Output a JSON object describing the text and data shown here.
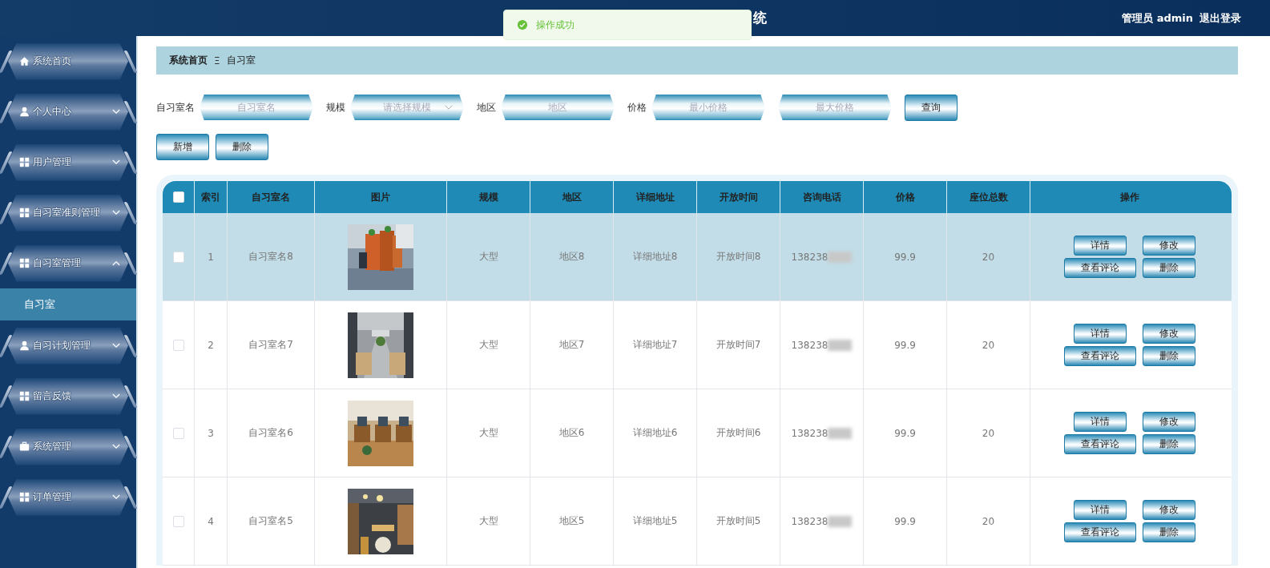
{
  "header": {
    "title": "统",
    "user": "管理员 admin",
    "logout": "退出登录"
  },
  "toast": {
    "kind": "success",
    "message": "操作成功"
  },
  "sidebar": {
    "items": [
      {
        "label": "系统首页"
      },
      {
        "label": "个人中心",
        "expanded": false
      },
      {
        "label": "用户管理",
        "expanded": false
      },
      {
        "label": "自习室准则管理",
        "expanded": false
      },
      {
        "label": "自习室管理",
        "expanded": true,
        "children": [
          {
            "label": "自习室",
            "selected": true
          }
        ]
      },
      {
        "label": "自习计划管理",
        "expanded": false
      },
      {
        "label": "留言反馈",
        "expanded": false
      },
      {
        "label": "系统管理",
        "expanded": false
      },
      {
        "label": "订单管理",
        "expanded": false
      }
    ]
  },
  "breadcrumb": {
    "items": [
      "系统首页",
      "自习室"
    ],
    "separator": "Ξ"
  },
  "search": {
    "fields": [
      {
        "label": "自习室名",
        "placeholder": "自习室名",
        "kind": "text"
      },
      {
        "label": "规模",
        "placeholder": "请选择规模",
        "kind": "select"
      },
      {
        "label": "地区",
        "placeholder": "地区",
        "kind": "text"
      },
      {
        "label": "价格",
        "placeholder": "最小价格",
        "kind": "text"
      },
      {
        "placeholder": "最大价格",
        "kind": "text"
      }
    ],
    "button": "查询"
  },
  "actions": [
    "新增",
    "删除"
  ],
  "table": {
    "all_checked": false,
    "columns": [
      "索引",
      "自习室名",
      "图片",
      "规模",
      "地区",
      "详细地址",
      "开放时间",
      "咨询电话",
      "价格",
      "座位总数",
      "操作"
    ],
    "rows": [
      {
        "checked": false,
        "hovered": true,
        "index": "1",
        "name": "自习室名8",
        "picture": {
          "kind": "picture"
        },
        "scale": "大型",
        "area": "地区8",
        "address": "详细地址8",
        "hours": "开放时间8",
        "phone": "138238",
        "phone_blurred": true,
        "price": "99.9",
        "seats": "20",
        "actions": [
          "详情",
          "修改",
          "查看评论",
          "删除"
        ]
      },
      {
        "checked": false,
        "hovered": false,
        "index": "2",
        "name": "自习室名7",
        "picture": {
          "kind": "picture"
        },
        "scale": "大型",
        "area": "地区7",
        "address": "详细地址7",
        "hours": "开放时间7",
        "phone": "138238",
        "phone_blurred": true,
        "price": "99.9",
        "seats": "20",
        "actions": [
          "详情",
          "修改",
          "查看评论",
          "删除"
        ]
      },
      {
        "checked": false,
        "hovered": false,
        "index": "3",
        "name": "自习室名6",
        "picture": {
          "kind": "picture"
        },
        "scale": "大型",
        "area": "地区6",
        "address": "详细地址6",
        "hours": "开放时间6",
        "phone": "138238",
        "phone_blurred": true,
        "price": "99.9",
        "seats": "20",
        "actions": [
          "详情",
          "修改",
          "查看评论",
          "删除"
        ]
      },
      {
        "checked": false,
        "hovered": false,
        "index": "4",
        "name": "自习室名5",
        "picture": {
          "kind": "picture"
        },
        "scale": "大型",
        "area": "地区5",
        "address": "详细地址5",
        "hours": "开放时间5",
        "phone": "138238",
        "phone_blurred": true,
        "price": "99.9",
        "seats": "20",
        "actions": [
          "详情",
          "修改",
          "查看评论",
          "删除"
        ]
      }
    ]
  }
}
